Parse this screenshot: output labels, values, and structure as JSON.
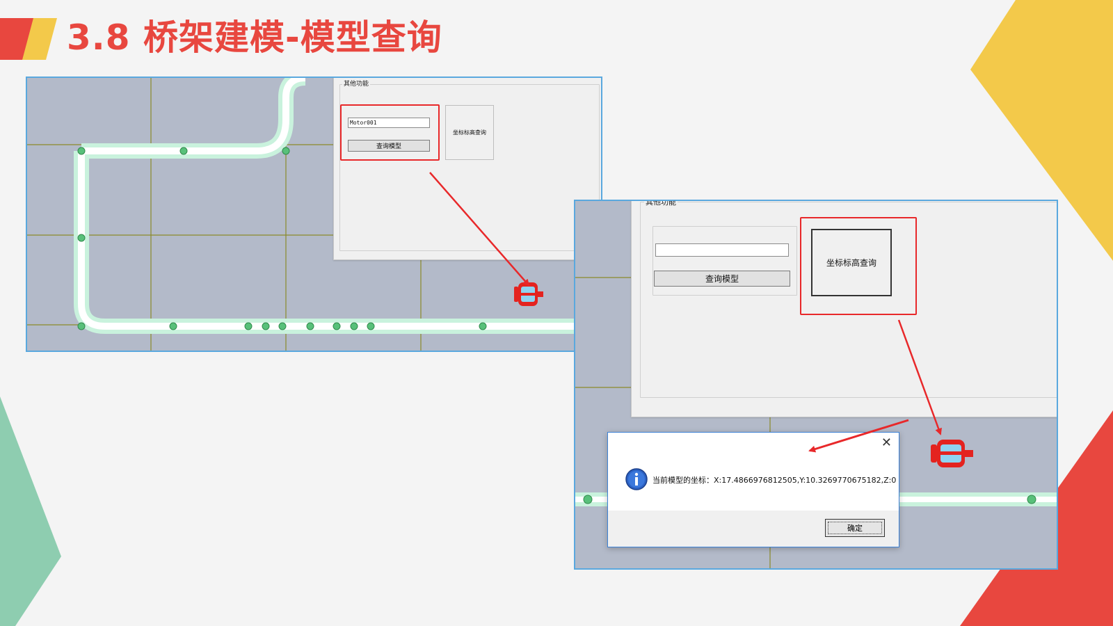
{
  "slide": {
    "title": "3.8 桥架建模-模型查询",
    "colors": {
      "accent_red": "#e8473f",
      "accent_yellow": "#f3c94a",
      "accent_green": "#8ecdb0",
      "frame_blue": "#5aa8de"
    }
  },
  "panel_left": {
    "group_title": "其他功能",
    "model_input_value": "Motor001",
    "query_model_button": "查询模型",
    "coord_query_button": "坐标标高查询",
    "icon": "motor-icon"
  },
  "panel_right": {
    "group_title": "其他功能",
    "model_input_value": "",
    "query_model_button": "查询模型",
    "coord_query_button": "坐标标高查询",
    "icon": "motor-icon"
  },
  "dialog": {
    "message": "当前模型的坐标：X:17.4866976812505,Y:10.3269770675182,Z:0",
    "ok_button": "确定",
    "icons": [
      "info-icon",
      "close-icon"
    ]
  }
}
